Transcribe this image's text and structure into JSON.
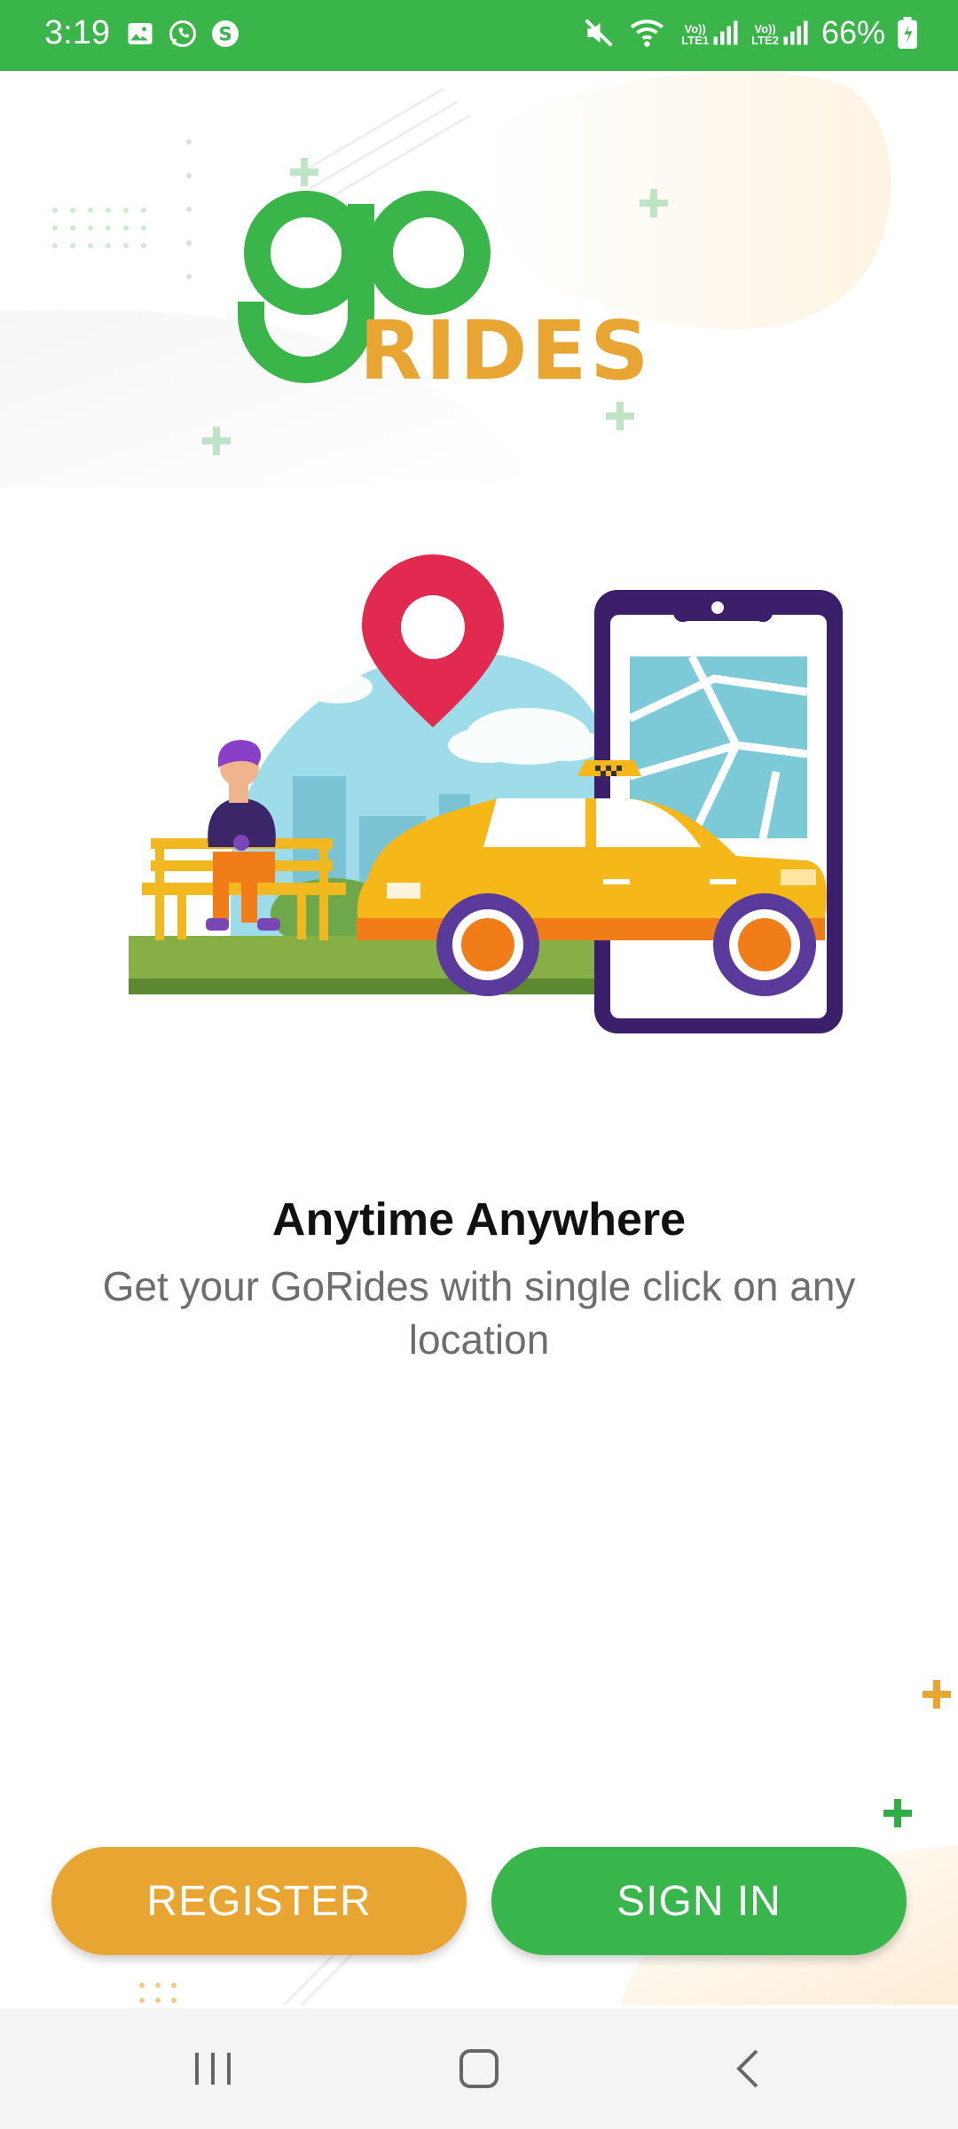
{
  "status_bar": {
    "time": "3:19",
    "battery": "66%",
    "sim1": "LTE1",
    "sim2": "LTE2",
    "icons": [
      "gallery-icon",
      "whatsapp-icon",
      "app-s-icon",
      "mute-icon",
      "wifi-icon",
      "signal-icon",
      "battery-icon"
    ]
  },
  "brand": {
    "green": "#3ab54a",
    "orange": "#e9a532"
  },
  "onboarding": {
    "title": "Anytime Anywhere",
    "subtitle": "Get your GoRides with single click on any location"
  },
  "buttons": {
    "register": "REGISTER",
    "sign_in": "SIGN IN"
  },
  "nav": {
    "icons": [
      "recent-apps-icon",
      "home-icon",
      "back-icon"
    ]
  }
}
